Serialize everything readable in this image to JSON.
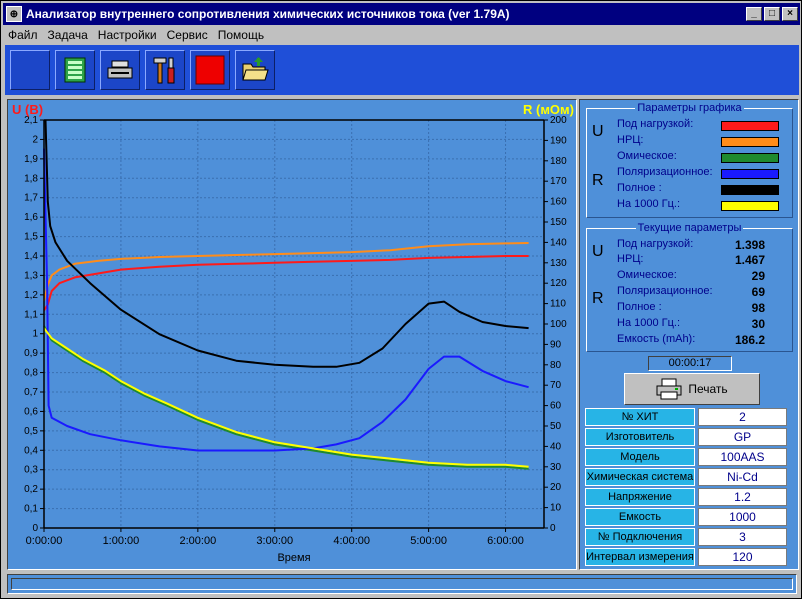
{
  "window": {
    "title": "Анализатор внутреннего сопротивления химических источников тока (ver 1.79A)",
    "minimize": "_",
    "maximize": "□",
    "close": "×"
  },
  "menu": [
    "Файл",
    "Задача",
    "Настройки",
    "Сервис",
    "Помощь"
  ],
  "toolbar": [
    "start-icon",
    "board-icon",
    "device-icon",
    "tools-icon",
    "stop-icon",
    "open-folder-icon"
  ],
  "colors": {
    "under_load": "#ff1a1a",
    "ocv": "#ff8c1a",
    "ohmic": "#1f8a2e",
    "polarization": "#1a1aff",
    "full": "#000000",
    "f1000": "#ffff00"
  },
  "chart_data": {
    "type": "line",
    "xlabel": "Время",
    "ylabel_left": "U (В)",
    "ylabel_right": "R (мОм)",
    "x_unit": "hours",
    "xlim": [
      0,
      6.5
    ],
    "x_ticks": [
      "0:00:00",
      "1:00:00",
      "2:00:00",
      "3:00:00",
      "4:00:00",
      "5:00:00",
      "6:00:00"
    ],
    "ylim_left": [
      0,
      2.1
    ],
    "ylim_right": [
      0,
      200
    ],
    "y_ticks_left": [
      "0",
      "0,1",
      "0,2",
      "0,3",
      "0,4",
      "0,5",
      "0,6",
      "0,7",
      "0,8",
      "0,9",
      "1",
      "1,1",
      "1,2",
      "1,3",
      "1,4",
      "1,5",
      "1,6",
      "1,7",
      "1,8",
      "1,9",
      "2",
      "2,1"
    ],
    "y_ticks_right": [
      "0",
      "10",
      "20",
      "30",
      "40",
      "50",
      "60",
      "70",
      "80",
      "90",
      "100",
      "110",
      "120",
      "130",
      "140",
      "150",
      "160",
      "170",
      "180",
      "190",
      "200"
    ],
    "grid": true,
    "series": [
      {
        "name": "Под нагрузкой",
        "axis": "left",
        "color": "#ff1a1a",
        "x": [
          0,
          0.05,
          0.1,
          0.2,
          0.4,
          0.7,
          1.0,
          1.5,
          2.0,
          2.5,
          3.0,
          3.5,
          4.0,
          4.5,
          5.0,
          5.5,
          6.0,
          6.3
        ],
        "y": [
          1.12,
          1.15,
          1.22,
          1.26,
          1.29,
          1.31,
          1.33,
          1.345,
          1.355,
          1.36,
          1.365,
          1.37,
          1.375,
          1.38,
          1.39,
          1.395,
          1.4,
          1.4
        ]
      },
      {
        "name": "НРЦ",
        "axis": "left",
        "color": "#ff8c1a",
        "x": [
          0,
          0.05,
          0.1,
          0.2,
          0.4,
          0.7,
          1.0,
          1.5,
          2.0,
          2.5,
          3.0,
          3.5,
          4.0,
          4.5,
          5.0,
          5.5,
          6.0,
          6.3
        ],
        "y": [
          1.17,
          1.25,
          1.3,
          1.33,
          1.36,
          1.375,
          1.385,
          1.395,
          1.4,
          1.405,
          1.41,
          1.415,
          1.42,
          1.43,
          1.45,
          1.46,
          1.465,
          1.467
        ]
      },
      {
        "name": "Омическое",
        "axis": "right",
        "color": "#1f8a2e",
        "x": [
          0,
          0.1,
          0.3,
          0.5,
          0.8,
          1.0,
          1.3,
          1.6,
          2.0,
          2.5,
          3.0,
          3.5,
          4.0,
          4.5,
          5.0,
          5.5,
          6.0,
          6.3
        ],
        "y": [
          99,
          92,
          87,
          82,
          76,
          71,
          65,
          60,
          53,
          46,
          41,
          38,
          35,
          33,
          31,
          30,
          30,
          29
        ]
      },
      {
        "name": "Поляризационное",
        "axis": "right",
        "color": "#1a1aff",
        "x": [
          0,
          0.04,
          0.06,
          0.1,
          0.3,
          0.6,
          1.0,
          1.5,
          2.0,
          2.5,
          3.0,
          3.5,
          3.8,
          4.1,
          4.4,
          4.7,
          5.0,
          5.2,
          5.4,
          5.7,
          6.0,
          6.3
        ],
        "y": [
          186,
          120,
          60,
          54,
          50,
          46,
          43,
          40,
          38,
          38,
          38,
          39,
          41,
          44,
          52,
          63,
          78,
          84,
          84,
          77,
          72,
          69
        ]
      },
      {
        "name": "Полное",
        "axis": "right",
        "color": "#000000",
        "x": [
          0.02,
          0.05,
          0.08,
          0.15,
          0.3,
          0.6,
          1.0,
          1.5,
          2.0,
          2.5,
          3.0,
          3.5,
          3.8,
          4.1,
          4.4,
          4.7,
          5.0,
          5.2,
          5.4,
          5.7,
          6.0,
          6.3
        ],
        "y": [
          200,
          160,
          148,
          140,
          131,
          120,
          107,
          95,
          87,
          82,
          80,
          79,
          79,
          81,
          88,
          100,
          110,
          111,
          106,
          101,
          99,
          98
        ]
      },
      {
        "name": "На 1000 Гц.",
        "axis": "right",
        "color": "#ffff00",
        "x": [
          0,
          0.1,
          0.3,
          0.5,
          0.8,
          1.0,
          1.3,
          1.6,
          2.0,
          2.5,
          3.0,
          3.5,
          4.0,
          4.5,
          5.0,
          5.5,
          6.0,
          6.3
        ],
        "y": [
          98,
          93,
          88,
          83,
          77,
          72,
          66,
          61,
          54,
          47,
          42,
          39,
          36,
          34,
          32,
          31,
          31,
          30
        ]
      }
    ]
  },
  "params": {
    "title": "Параметры графика",
    "u_label": "U",
    "r_label": "R",
    "under_load": "Под нагрузкой:",
    "ocv": "НРЦ:",
    "ohmic": "Омическое:",
    "polarization": "Поляризационное:",
    "full": "Полное :",
    "f1000": "На 1000 Гц.:"
  },
  "current": {
    "title": "Текущие параметры",
    "u_label": "U",
    "r_label": "R",
    "under_load_label": "Под нагрузкой:",
    "under_load": "1.398",
    "ocv_label": "НРЦ:",
    "ocv": "1.467",
    "ohmic_label": "Омическое:",
    "ohmic": "29",
    "polarization_label": "Поляризационное:",
    "polarization": "69",
    "full_label": "Полное :",
    "full": "98",
    "f1000_label": "На 1000 Гц.:",
    "f1000": "30",
    "capacity_label": "Емкость (mAh):",
    "capacity": "186.2"
  },
  "timer": "00:00:17",
  "print_label": "Печать",
  "info": [
    {
      "label": "№ ХИТ",
      "value": "2"
    },
    {
      "label": "Изготовитель",
      "value": "GP"
    },
    {
      "label": "Модель",
      "value": "100AAS"
    },
    {
      "label": "Химическая система",
      "value": "Ni-Cd"
    },
    {
      "label": "Напряжение",
      "value": "1.2"
    },
    {
      "label": "Емкость",
      "value": "1000"
    },
    {
      "label": "№ Подключения",
      "value": "3"
    },
    {
      "label": "Интервал измерения",
      "value": "120"
    }
  ]
}
